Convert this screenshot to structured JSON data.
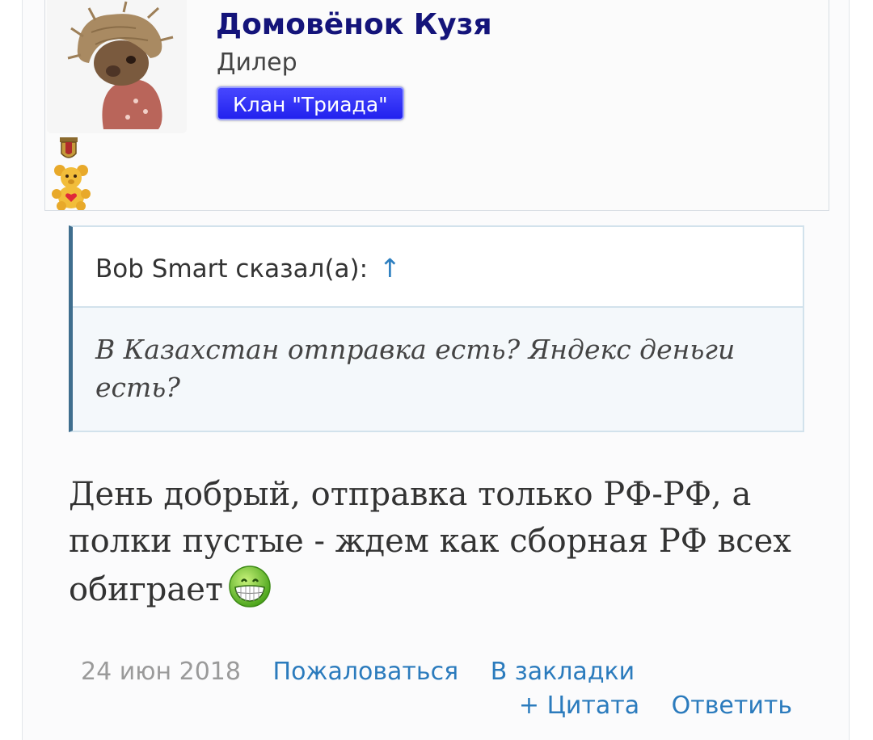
{
  "user": {
    "name": "Домовёнок Кузя",
    "title": "Дилер",
    "clan": "Клан \"Триада\""
  },
  "quote": {
    "author_label": "Bob Smart сказал(а):",
    "arrow": "↑",
    "text": "В Казахстан отправка есть? Яндекс деньги есть?"
  },
  "message": {
    "text": "День добрый, отправка только РФ-РФ, а полки пустые - ждем как сборная РФ всех обиграет"
  },
  "footer": {
    "date": "24 июн 2018",
    "report_label": "Пожаловаться",
    "bookmark_label": "В закладки",
    "quote_label": "+ Цитата",
    "reply_label": "Ответить"
  },
  "colors": {
    "username": "#14147a",
    "clan_badge": "#2b2bf5",
    "link": "#2b7bbd",
    "quote_border": "#3f6e8e"
  }
}
